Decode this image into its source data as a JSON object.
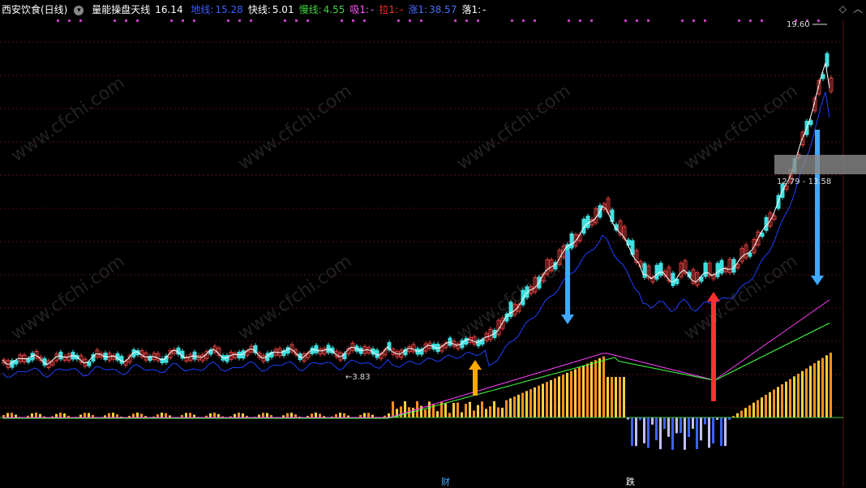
{
  "header": {
    "title": "西安饮食(日线)",
    "toggle_icon": "chevron-down-icon",
    "indicator_name": "量能操盘天线",
    "first_value": "16.14",
    "items": [
      {
        "label": "地线",
        "value": "15.28",
        "color": "#3b5bff"
      },
      {
        "label": "快线",
        "value": "5.01",
        "color": "#ffffff"
      },
      {
        "label": "慢线",
        "value": "4.55",
        "color": "#42d442"
      },
      {
        "label": "吸1",
        "value": "-",
        "color": "#ff55ff"
      },
      {
        "label": "拉1",
        "value": "-",
        "color": "#ff3030"
      },
      {
        "label": "涨1",
        "value": "38.57",
        "color": "#4a6cff"
      },
      {
        "label": "落1",
        "value": "-",
        "color": "#ffffff"
      }
    ]
  },
  "top_right": {
    "diamond_icon": "diamond-icon",
    "up_icon": "chevron-up-icon"
  },
  "annotations": {
    "high_price": "19.60",
    "low_price": "3.83",
    "range": "12.79 - 13.58",
    "watermark": "www.cfchi.com"
  },
  "bottom_marks": [
    {
      "text": "财",
      "color": "#3fa9ff"
    },
    {
      "text": "跌",
      "color": "#ffffff"
    }
  ],
  "colors": {
    "up": "#e04040",
    "down": "#40e0e0",
    "ma_white": "#ffffff",
    "ma_blue": "#2040ff",
    "ind_pink": "#ff40ff",
    "ind_green": "#40ff40",
    "bar_yellow": "#ffd040",
    "bar_orange": "#ff9020",
    "arrow_blue": "#3fa9ff",
    "arrow_red": "#ff3030",
    "arrow_orange": "#ffaa00"
  }
}
